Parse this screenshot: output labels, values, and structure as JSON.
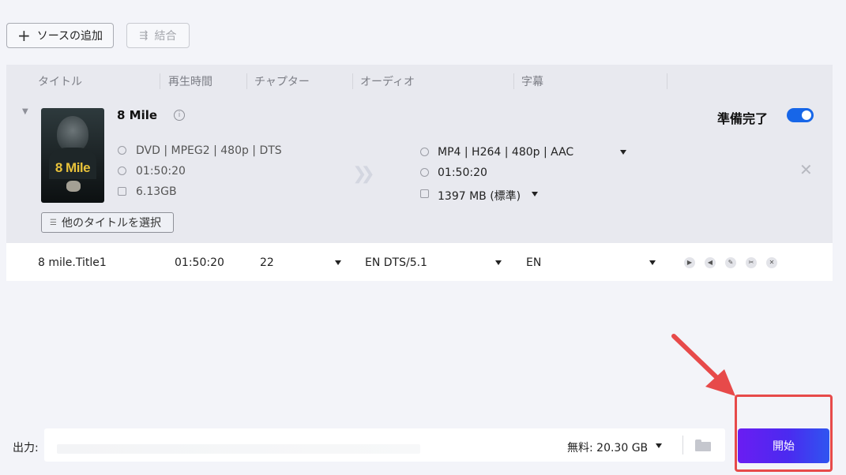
{
  "toolbar": {
    "add_source_label": "ソースの追加",
    "merge_label": "結合"
  },
  "table_header": {
    "title": "タイトル",
    "duration": "再生時間",
    "chapter": "チャプター",
    "audio": "オーディオ",
    "subtitle": "字幕"
  },
  "item": {
    "name": "8 Mile",
    "poster_text": "8 Mile",
    "source_format": "DVD | MPEG2 | 480p | DTS",
    "source_duration": "01:50:20",
    "source_size": "6.13GB",
    "output_format": "MP4 | H264 | 480p | AAC",
    "output_duration": "01:50:20",
    "output_size": "1397 MB (標準)",
    "status": "準備完了",
    "select_other_titles": "他のタイトルを選択",
    "toggle_on": true
  },
  "title_row": {
    "name": "8 mile.Title1",
    "duration": "01:50:20",
    "chapter": "22",
    "audio": "EN  DTS/5.1",
    "subtitle": "EN"
  },
  "output": {
    "label": "出力:",
    "free_space": "無料:  20.30 GB"
  },
  "start_label": "開始",
  "colors": {
    "accent": "#1766e8",
    "start_gradient_from": "#6a1df2",
    "start_gradient_to": "#2f55f0",
    "annotation": "#e74a4a"
  }
}
